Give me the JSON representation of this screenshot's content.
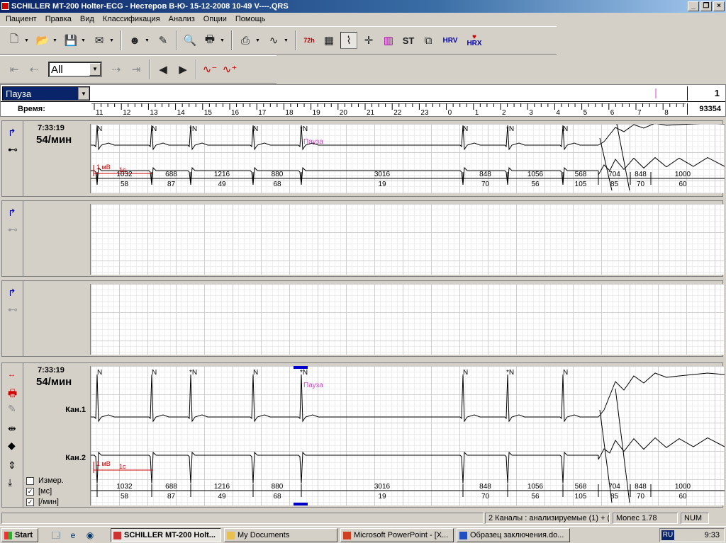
{
  "window": {
    "title": "SCHILLER MT-200 Holter-ECG - Нестеров В-Ю- 15-12-2008 10-49 V----.QRS"
  },
  "menu": [
    "Пациент",
    "Правка",
    "Вид",
    "Классификация",
    "Анализ",
    "Опции",
    "Помощь"
  ],
  "toolbar": {
    "btn_72h": "72h",
    "btn_st": "ST",
    "btn_hrv": "HRV",
    "btn_hrx": "HRX"
  },
  "nav": {
    "filter": "All"
  },
  "event_bar": {
    "selected": "Пауза",
    "count": "1",
    "time_label": "Время:",
    "total": "93354",
    "hours": [
      "11",
      "12",
      "13",
      "14",
      "15",
      "16",
      "17",
      "18",
      "19",
      "20",
      "21",
      "22",
      "23",
      "0",
      "1",
      "2",
      "3",
      "4",
      "5",
      "6",
      "7",
      "8"
    ]
  },
  "panel1": {
    "time": "7:33:19",
    "rate": "54/мин"
  },
  "panel4": {
    "time": "7:33:19",
    "rate": "54/мин",
    "ch1": "Кан.1",
    "ch2": "Кан.2",
    "chk_measure": "Измер.",
    "chk_ms": "[мс]",
    "chk_min": "[/мин]"
  },
  "ecg": {
    "beats": [
      "N",
      "N",
      "*N",
      "N",
      "*N",
      "N",
      "*N",
      "N"
    ],
    "pause_label": "Пауза",
    "scale_mv": "1 мВ",
    "scale_s": "1с",
    "rr_ms": [
      "1032",
      "688",
      "1216",
      "880",
      "3016",
      "848",
      "1056",
      "568",
      "704",
      "848",
      "1000"
    ],
    "hr": [
      "58",
      "87",
      "49",
      "68",
      "19",
      "70",
      "56",
      "105",
      "85",
      "70",
      "60"
    ]
  },
  "status": {
    "channels": "2 Каналы : анализируемые (1) + (",
    "monec": "Monec 1.78",
    "num": "NUM"
  },
  "taskbar": {
    "start": "Start",
    "clock": "9:33",
    "lang": "RU",
    "tasks": [
      "SCHILLER MT-200 Holt...",
      "My Documents",
      "Microsoft PowerPoint - [Х...",
      "Образец заключения.do..."
    ]
  },
  "colors": {
    "title_start": "#0a246a",
    "pause_label": "#d040d0",
    "scale_red": "#cc0000",
    "marker_blue": "#0000cc"
  }
}
